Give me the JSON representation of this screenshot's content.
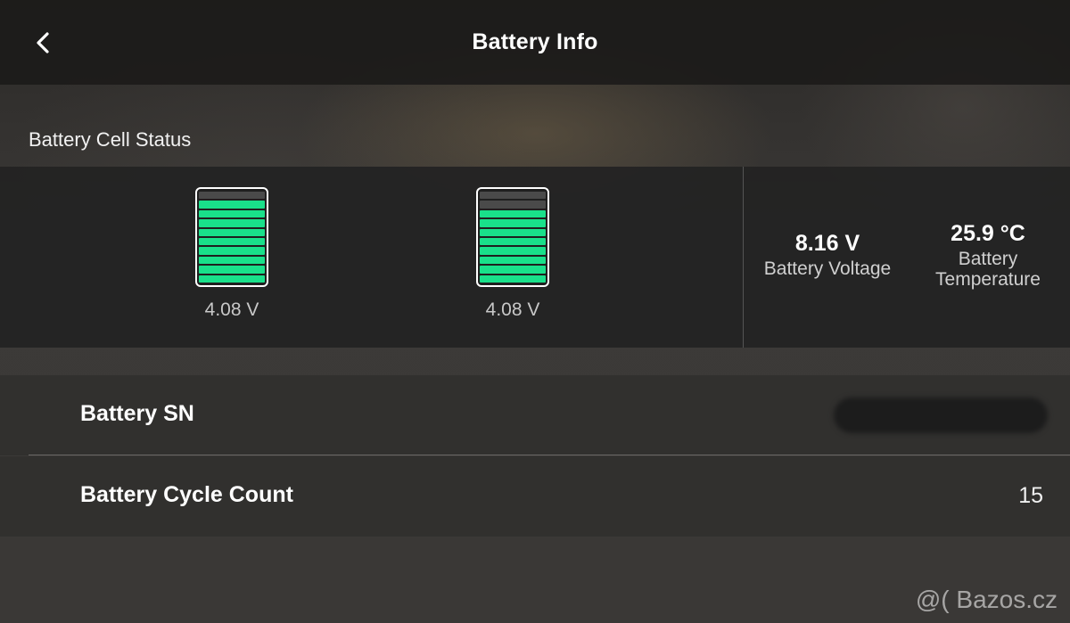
{
  "header": {
    "title": "Battery Info",
    "back_icon": "chevron-left-icon"
  },
  "cell_status": {
    "title": "Battery Cell Status",
    "cells": [
      {
        "voltage": "4.08 V",
        "level_bars": 9,
        "total_bars": 10
      },
      {
        "voltage": "4.08 V",
        "level_bars": 8,
        "total_bars": 10
      }
    ],
    "battery_voltage": {
      "value": "8.16 V",
      "label": "Battery Voltage"
    },
    "battery_temperature": {
      "value": "25.9 °C",
      "label": "Battery Temperature"
    },
    "colors": {
      "cell_fill": "#19e08a",
      "cell_empty": "#4a4a4a"
    }
  },
  "rows": {
    "sn": {
      "label": "Battery SN",
      "value_redacted": true
    },
    "cycle_count": {
      "label": "Battery Cycle Count",
      "value": "15"
    }
  },
  "watermark": "@( Bazos.cz"
}
